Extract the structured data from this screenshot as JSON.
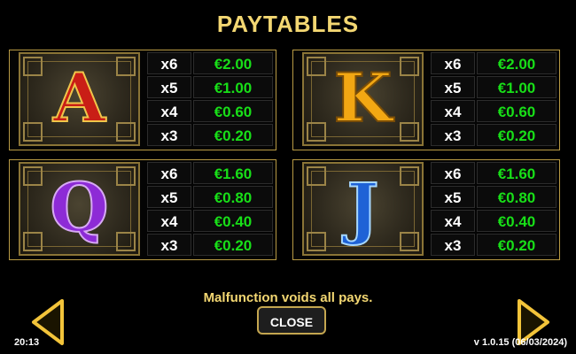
{
  "title": "PAYTABLES",
  "paytables": [
    {
      "symbol": "A",
      "rows": [
        {
          "multiplier": "x6",
          "value": "€2.00"
        },
        {
          "multiplier": "x5",
          "value": "€1.00"
        },
        {
          "multiplier": "x4",
          "value": "€0.60"
        },
        {
          "multiplier": "x3",
          "value": "€0.20"
        }
      ]
    },
    {
      "symbol": "K",
      "rows": [
        {
          "multiplier": "x6",
          "value": "€2.00"
        },
        {
          "multiplier": "x5",
          "value": "€1.00"
        },
        {
          "multiplier": "x4",
          "value": "€0.60"
        },
        {
          "multiplier": "x3",
          "value": "€0.20"
        }
      ]
    },
    {
      "symbol": "Q",
      "rows": [
        {
          "multiplier": "x6",
          "value": "€1.60"
        },
        {
          "multiplier": "x5",
          "value": "€0.80"
        },
        {
          "multiplier": "x4",
          "value": "€0.40"
        },
        {
          "multiplier": "x3",
          "value": "€0.20"
        }
      ]
    },
    {
      "symbol": "J",
      "rows": [
        {
          "multiplier": "x6",
          "value": "€1.60"
        },
        {
          "multiplier": "x5",
          "value": "€0.80"
        },
        {
          "multiplier": "x4",
          "value": "€0.40"
        },
        {
          "multiplier": "x3",
          "value": "€0.20"
        }
      ]
    }
  ],
  "notice": "Malfunction voids all pays.",
  "close_label": "CLOSE",
  "time": "20:13",
  "version": "v 1.0.15 (06/03/2024)",
  "icons": {
    "prev": "chevron-left-icon",
    "next": "chevron-right-icon"
  },
  "colors": {
    "gold": "#f3d772",
    "value_green": "#18df18"
  }
}
